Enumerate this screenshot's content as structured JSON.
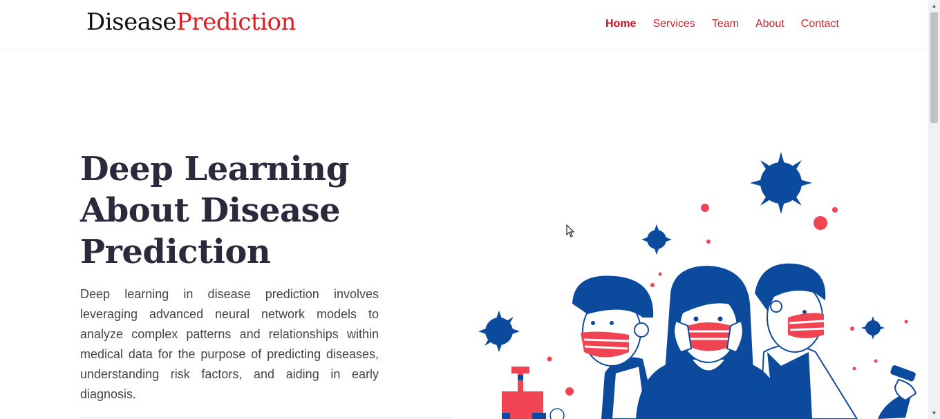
{
  "brand": {
    "first": "Disease",
    "second": "Prediction"
  },
  "nav": {
    "items": [
      {
        "label": "Home",
        "active": true
      },
      {
        "label": "Services"
      },
      {
        "label": "Team"
      },
      {
        "label": "About"
      },
      {
        "label": "Contact"
      }
    ]
  },
  "hero": {
    "title": "Deep Learning About Disease Prediction",
    "description": "Deep learning in disease prediction involves leveraging advanced neural network models to analyze complex patterns and relationships within medical data for the purpose of predicting diseases, understanding risk factors, and aiding in early diagnosis."
  },
  "colors": {
    "accent": "#e31b23",
    "navy": "#0c4a9e",
    "mask_red": "#f04452",
    "text": "#2b2a3d"
  },
  "icons": {
    "scroll_up": "scroll-up-arrow",
    "scroll_down": "scroll-down-arrow",
    "cursor": "mouse-pointer"
  }
}
